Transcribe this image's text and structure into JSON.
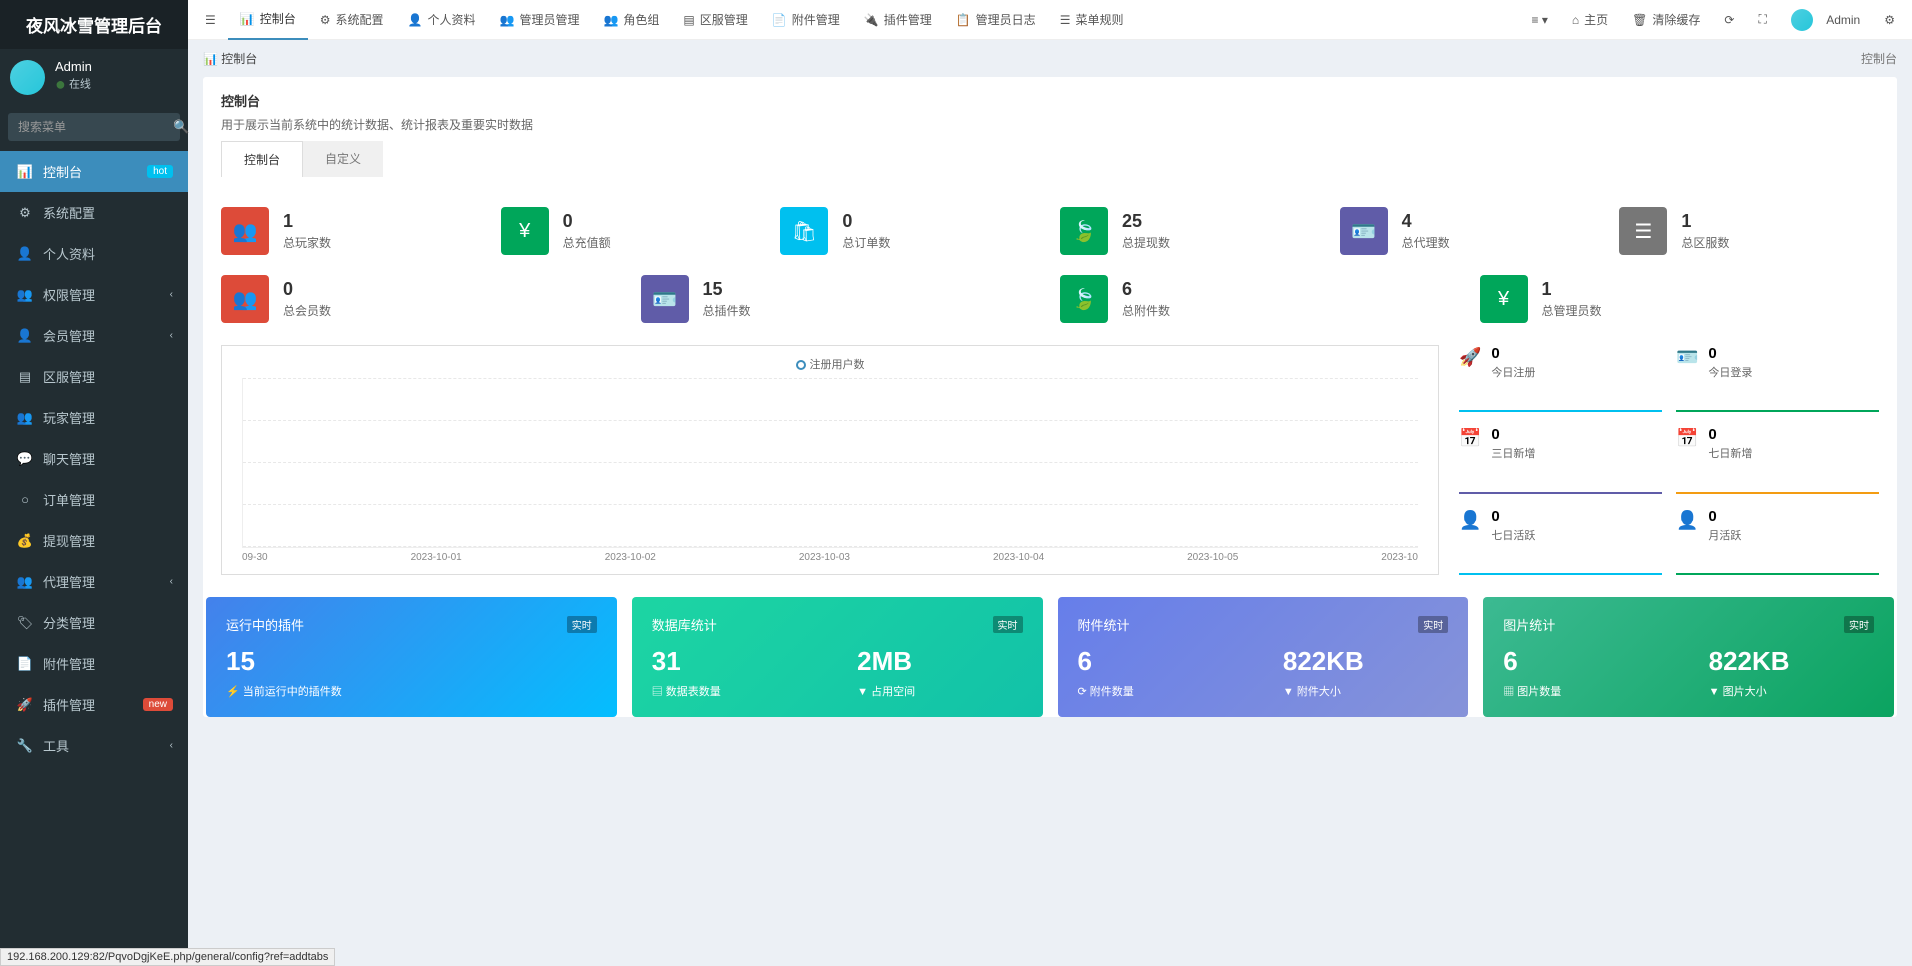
{
  "app_title": "夜风冰雪管理后台",
  "user": {
    "name": "Admin",
    "status": "在线"
  },
  "search_placeholder": "搜索菜单",
  "sidebar": [
    {
      "icon": "dashboard",
      "label": "控制台",
      "active": true,
      "badge": "hot",
      "badge_cls": "hot"
    },
    {
      "icon": "cog",
      "label": "系统配置"
    },
    {
      "icon": "user",
      "label": "个人资料"
    },
    {
      "icon": "users",
      "label": "权限管理",
      "chev": true
    },
    {
      "icon": "user-circle",
      "label": "会员管理",
      "chev": true
    },
    {
      "icon": "server",
      "label": "区服管理"
    },
    {
      "icon": "players",
      "label": "玩家管理"
    },
    {
      "icon": "wechat",
      "label": "聊天管理"
    },
    {
      "icon": "circle",
      "label": "订单管理"
    },
    {
      "icon": "money",
      "label": "提现管理"
    },
    {
      "icon": "sitemap",
      "label": "代理管理",
      "chev": true
    },
    {
      "icon": "tags",
      "label": "分类管理"
    },
    {
      "icon": "file",
      "label": "附件管理"
    },
    {
      "icon": "rocket",
      "label": "插件管理",
      "badge": "new",
      "badge_cls": "new"
    },
    {
      "icon": "wrench",
      "label": "工具",
      "chev": true
    }
  ],
  "topnav": [
    {
      "label": "控制台",
      "active": true
    },
    {
      "label": "系统配置"
    },
    {
      "label": "个人资料"
    },
    {
      "label": "管理员管理"
    },
    {
      "label": "角色组"
    },
    {
      "label": "区服管理"
    },
    {
      "label": "附件管理"
    },
    {
      "label": "插件管理"
    },
    {
      "label": "管理员日志"
    },
    {
      "label": "菜单规则"
    }
  ],
  "topright": {
    "home": "主页",
    "clear": "清除缓存",
    "admin": "Admin"
  },
  "breadcrumb": {
    "left": "控制台",
    "right": "控制台"
  },
  "panel": {
    "title": "控制台",
    "desc": "用于展示当前系统中的统计数据、统计报表及重要实时数据"
  },
  "tabs": [
    "控制台",
    "自定义"
  ],
  "stats1": [
    {
      "cls": "red",
      "val": "1",
      "lbl": "总玩家数"
    },
    {
      "cls": "green",
      "val": "0",
      "lbl": "总充值额"
    },
    {
      "cls": "teal",
      "val": "0",
      "lbl": "总订单数"
    },
    {
      "cls": "green2",
      "val": "25",
      "lbl": "总提现数"
    },
    {
      "cls": "purple",
      "val": "4",
      "lbl": "总代理数"
    },
    {
      "cls": "gray",
      "val": "1",
      "lbl": "总区服数"
    }
  ],
  "stats2": [
    {
      "cls": "red",
      "val": "0",
      "lbl": "总会员数"
    },
    {
      "cls": "purple",
      "val": "15",
      "lbl": "总插件数"
    },
    {
      "cls": "green2",
      "val": "6",
      "lbl": "总附件数"
    },
    {
      "cls": "green",
      "val": "1",
      "lbl": "总管理员数"
    }
  ],
  "chart": {
    "legend": "注册用户数",
    "x": [
      "09-30",
      "2023-10-01",
      "2023-10-02",
      "2023-10-03",
      "2023-10-04",
      "2023-10-05",
      "2023-10"
    ]
  },
  "sidestats": [
    {
      "val": "0",
      "lbl": "今日注册",
      "bc": "bc-teal"
    },
    {
      "val": "0",
      "lbl": "今日登录",
      "bc": "bc-green"
    },
    {
      "val": "0",
      "lbl": "三日新增",
      "bc": "bc-purple"
    },
    {
      "val": "0",
      "lbl": "七日新增",
      "bc": "bc-orange"
    },
    {
      "val": "0",
      "lbl": "七日活跃",
      "bc": "bc-teal"
    },
    {
      "val": "0",
      "lbl": "月活跃",
      "bc": "bc-green"
    }
  ],
  "cards": [
    {
      "cls": "c1",
      "title": "运行中的插件",
      "rt": "实时",
      "v1": "15",
      "l1": "⚡ 当前运行中的插件数"
    },
    {
      "cls": "c2",
      "title": "数据库统计",
      "rt": "实时",
      "v1": "31",
      "l1": "▤ 数据表数量",
      "v2": "2MB",
      "l2": "▼ 占用空间"
    },
    {
      "cls": "c3",
      "title": "附件统计",
      "rt": "实时",
      "v1": "6",
      "l1": "⟳ 附件数量",
      "v2": "822KB",
      "l2": "▼ 附件大小"
    },
    {
      "cls": "c4",
      "title": "图片统计",
      "rt": "实时",
      "v1": "6",
      "l1": "▦ 图片数量",
      "v2": "822KB",
      "l2": "▼ 图片大小"
    }
  ],
  "status_url": "192.168.200.129:82/PqvoDgjKeE.php/general/config?ref=addtabs",
  "chart_data": {
    "type": "line",
    "title": "注册用户数",
    "x": [
      "09-30",
      "2023-10-01",
      "2023-10-02",
      "2023-10-03",
      "2023-10-04",
      "2023-10-05",
      "2023-10"
    ],
    "series": [
      {
        "name": "注册用户数",
        "values": [
          0,
          0,
          0,
          0,
          0,
          0,
          0
        ]
      }
    ],
    "ylim": [
      0,
      1
    ]
  }
}
